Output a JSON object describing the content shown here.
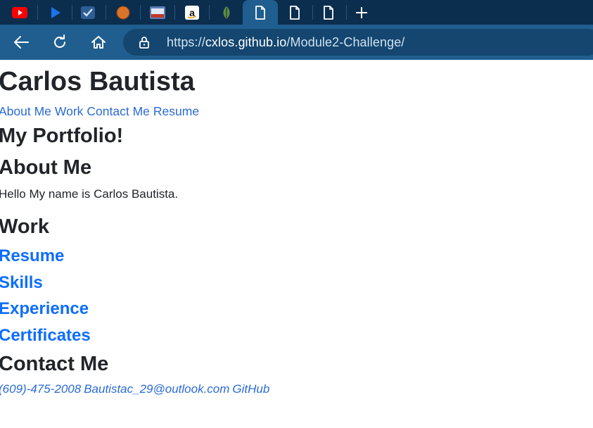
{
  "browser": {
    "tabs": [
      {
        "icon": "youtube-icon",
        "color": "#ff0000"
      },
      {
        "icon": "play-icon",
        "color": "#1a73e8"
      },
      {
        "icon": "checklist-icon",
        "color": "#3f6fb0"
      },
      {
        "icon": "orange-circle-icon",
        "color": "#d8752a"
      },
      {
        "icon": "flag-icon",
        "color": "#c0392b"
      },
      {
        "icon": "amazon-icon",
        "color": "#ffffff"
      },
      {
        "icon": "leaf-icon",
        "color": "#6f9a50"
      },
      {
        "icon": "page-icon",
        "color": "#ffffff"
      },
      {
        "icon": "page-icon",
        "color": "#ffffff"
      },
      {
        "icon": "page-icon",
        "color": "#ffffff"
      }
    ],
    "url_prefix": "https://",
    "url_host": "cxlos.github.io",
    "url_path": "/Module2-Challenge/"
  },
  "page": {
    "title": "Carlos Bautista",
    "nav": [
      "About Me",
      "Work",
      "Contact Me",
      "Resume"
    ],
    "portfolio_heading": "My Portfolio!",
    "about_heading": "About Me",
    "about_text": "Hello My name is Carlos Bautista.",
    "work_heading": "Work",
    "work_links": [
      "Resume",
      "Skills",
      "Experience",
      "Certificates"
    ],
    "contact_heading": "Contact Me",
    "contact_items": [
      "(609)-475-2008",
      "Bautistac_29@outlook.com",
      "GitHub"
    ]
  },
  "colors": {
    "tabbar": "#0b2e4e",
    "toolbar": "#1f5e8f",
    "link": "#0d6efd"
  }
}
